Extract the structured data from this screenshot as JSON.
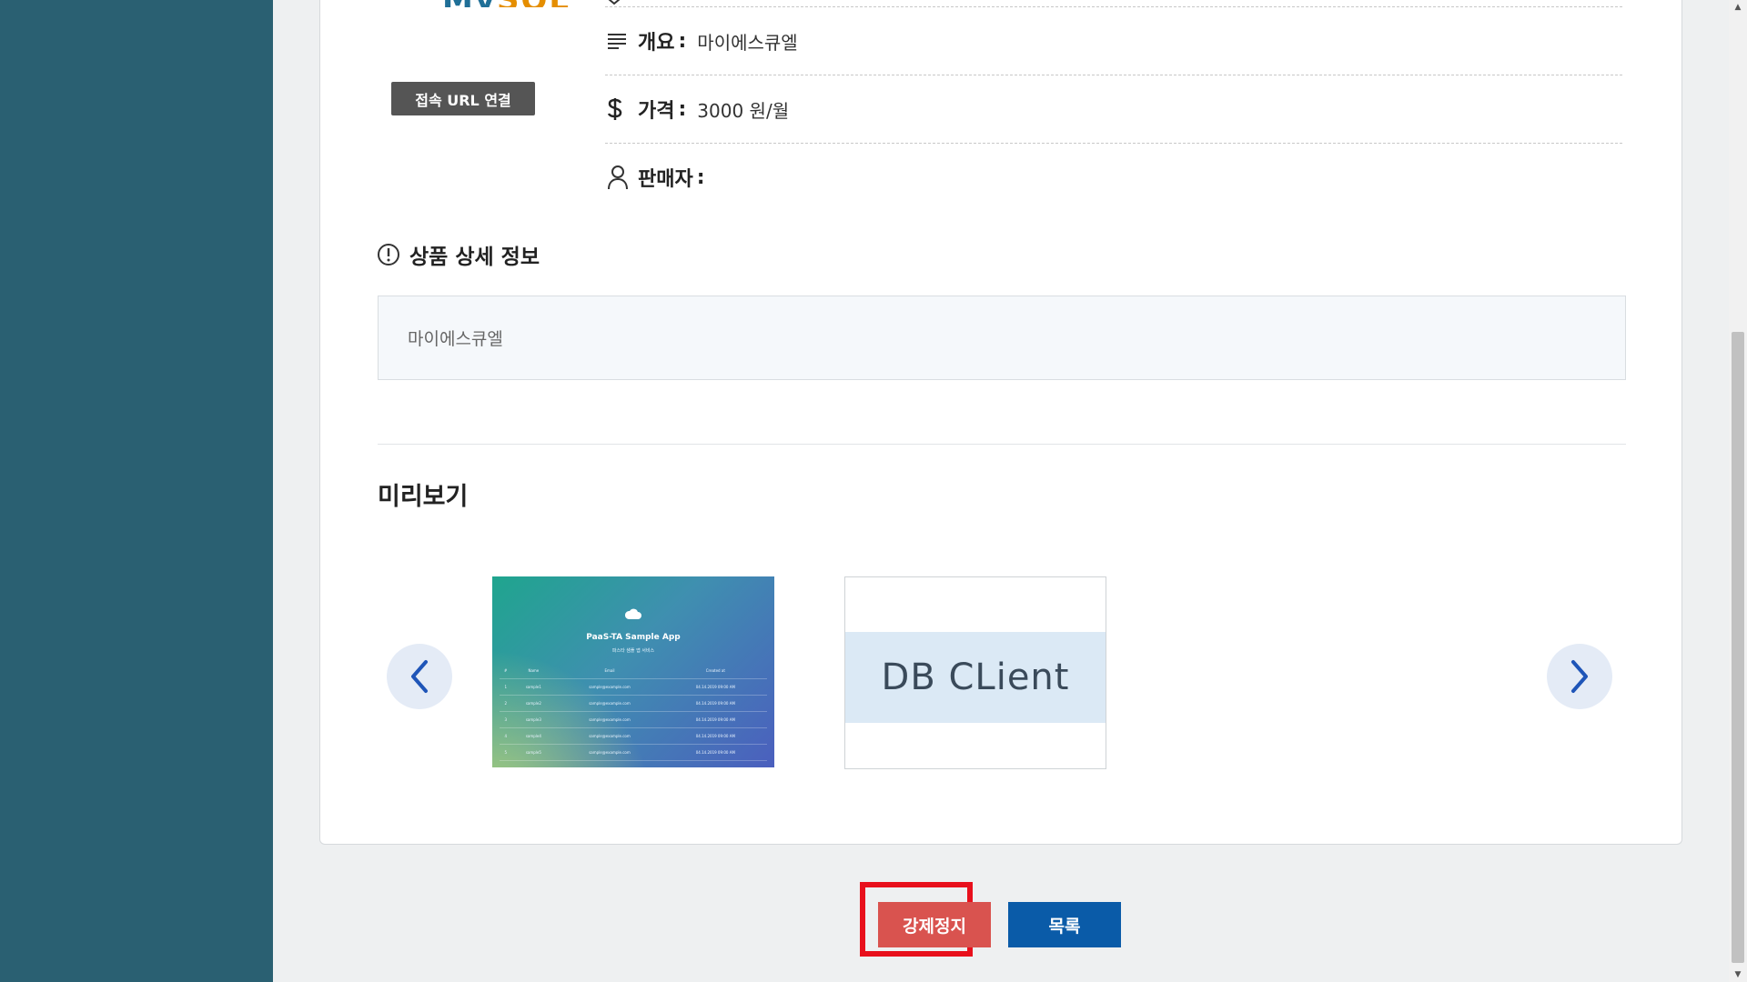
{
  "brand": {
    "logo_part1": "My",
    "logo_part2": "SQL"
  },
  "product": {
    "connect_url_button": "접속 URL 연결",
    "summary_label": "개요",
    "summary_value": "마이에스큐엘",
    "price_label": "가격",
    "price_value": "3000 원/월",
    "seller_label": "판매자",
    "seller_value": "",
    "colon": ":"
  },
  "detail": {
    "title": "상품 상세 정보",
    "text": "마이에스큐엘"
  },
  "preview": {
    "title": "미리보기",
    "thumb1": {
      "app_title": "PaaS-TA Sample App",
      "subtitle": "파스타 샘플 앱 서비스",
      "headers": [
        "#",
        "Name",
        "Email",
        "Created at"
      ],
      "rows": [
        [
          "1",
          "sample1",
          "sample@example.com",
          "04.14.2019 09:00 AM"
        ],
        [
          "2",
          "sample2",
          "sample@example.com",
          "04.14.2019 09:00 AM"
        ],
        [
          "3",
          "sample3",
          "sample@example.com",
          "04.14.2019 09:00 AM"
        ],
        [
          "4",
          "sample4",
          "sample@example.com",
          "04.14.2019 09:00 AM"
        ],
        [
          "5",
          "sample5",
          "sample@example.com",
          "04.14.2019 09:00 AM"
        ]
      ]
    },
    "thumb2": {
      "text": "DB CLient"
    }
  },
  "actions": {
    "force_stop": "강제정지",
    "list": "목록"
  },
  "colors": {
    "sidebar": "#2a6072",
    "stop": "#d9534f",
    "list": "#0a5ba8",
    "highlight": "#e8101c"
  }
}
